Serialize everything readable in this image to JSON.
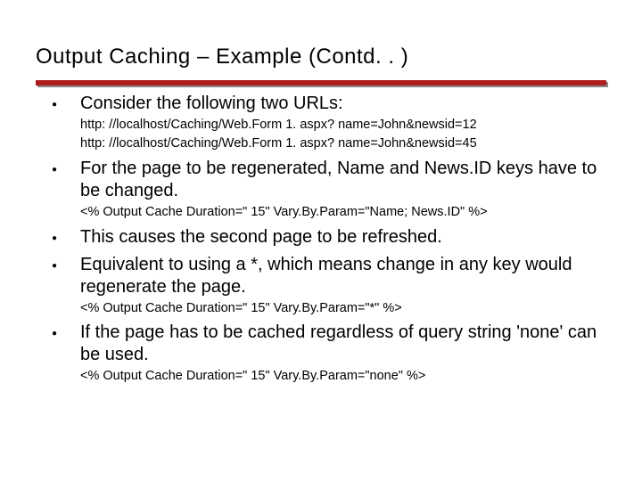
{
  "title": "Output Caching – Example (Contd. . )",
  "items": {
    "b1": "Consider the following two URLs:",
    "url1": "http: //localhost/Caching/Web.Form 1. aspx? name=John&newsid=12",
    "url2": "http: //localhost/Caching/Web.Form 1. aspx? name=John&newsid=45",
    "b2": "For the page to be regenerated, Name and News.ID keys have to be changed.",
    "code1": "<% Output Cache Duration=\" 15\"  Vary.By.Param=\"Name; News.ID\" %>",
    "b3": "This causes the second page to be refreshed.",
    "b4": "Equivalent to using a *, which means change in any key would regenerate the page.",
    "code2": "<% Output Cache Duration=\" 15\"  Vary.By.Param=\"*\" %>",
    "b5": "If the page has to be cached regardless of query string 'none' can be used.",
    "code3": "<% Output Cache Duration=\" 15\" Vary.By.Param=\"none\" %>"
  }
}
